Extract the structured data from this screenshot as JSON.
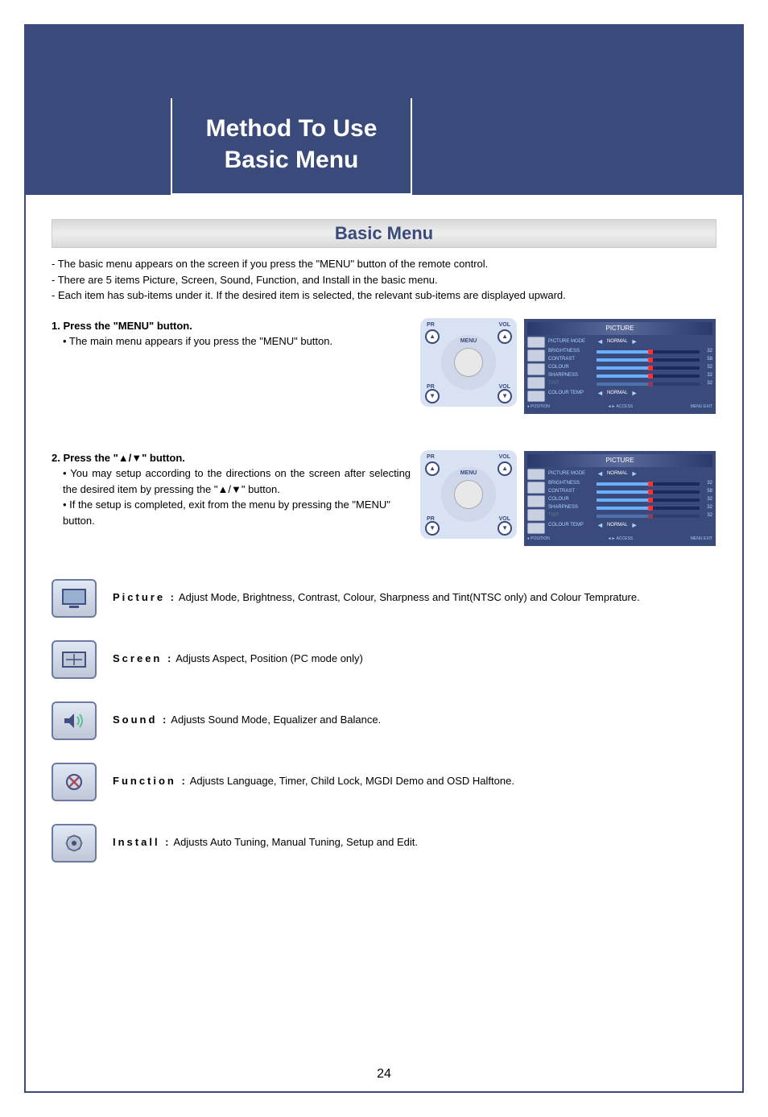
{
  "page": {
    "title_line1": "Method To Use",
    "title_line2": "Basic Menu",
    "page_number": "24"
  },
  "section": {
    "heading": "Basic Menu",
    "intro": [
      "- The basic menu appears on the screen if you press the \"MENU\" button of the remote control.",
      "- There are 5 items Picture, Screen, Sound, Function, and Install in the basic menu.",
      "- Each item has sub-items under it. If the desired item is selected, the relevant sub-items are displayed upward."
    ]
  },
  "steps": [
    {
      "title": "1. Press the \"MENU\" button.",
      "bullets": [
        "• The main menu appears if you press the \"MENU\" button."
      ]
    },
    {
      "title": "2. Press the \"▲/▼\" button.",
      "bullets": [
        "• You may setup according to the directions on the screen after selecting the desired item by pressing the \"▲/▼\" button.",
        "• If the setup is completed, exit from the menu by pressing the \"MENU\" button."
      ]
    }
  ],
  "remote": {
    "labels": {
      "pr": "PR",
      "vol": "VOL",
      "menu": "MENU"
    }
  },
  "osd": {
    "title": "PICTURE",
    "rows": [
      {
        "label": "PICTURE MODE",
        "type": "enum",
        "value": "NORMAL"
      },
      {
        "label": "BRIGHTNESS",
        "type": "bar",
        "value": "32"
      },
      {
        "label": "CONTRAST",
        "type": "bar",
        "value": "58"
      },
      {
        "label": "COLOUR",
        "type": "bar",
        "value": "32"
      },
      {
        "label": "SHARPNESS",
        "type": "bar",
        "value": "32"
      },
      {
        "label": "TINT",
        "type": "bar",
        "value": "32",
        "dim": true
      },
      {
        "label": "COLOUR TEMP",
        "type": "enum",
        "value": "NORMAL"
      }
    ],
    "footer": {
      "position": "POSITION",
      "access": "ACCESS",
      "exit": "EXIT",
      "menu": "MENU"
    }
  },
  "defs": [
    {
      "label": "Picture :",
      "text": "Adjust Mode, Brightness, Contrast, Colour, Sharpness and Tint(NTSC only) and Colour Temprature."
    },
    {
      "label": "Screen :",
      "text": "Adjusts Aspect, Position (PC mode only)"
    },
    {
      "label": "Sound :",
      "text": "Adjusts Sound Mode, Equalizer and Balance."
    },
    {
      "label": "Function :",
      "text": "Adjusts Language, Timer, Child Lock, MGDI Demo and OSD Halftone."
    },
    {
      "label": "Install :",
      "text": "Adjusts Auto Tuning, Manual Tuning, Setup and Edit."
    }
  ]
}
